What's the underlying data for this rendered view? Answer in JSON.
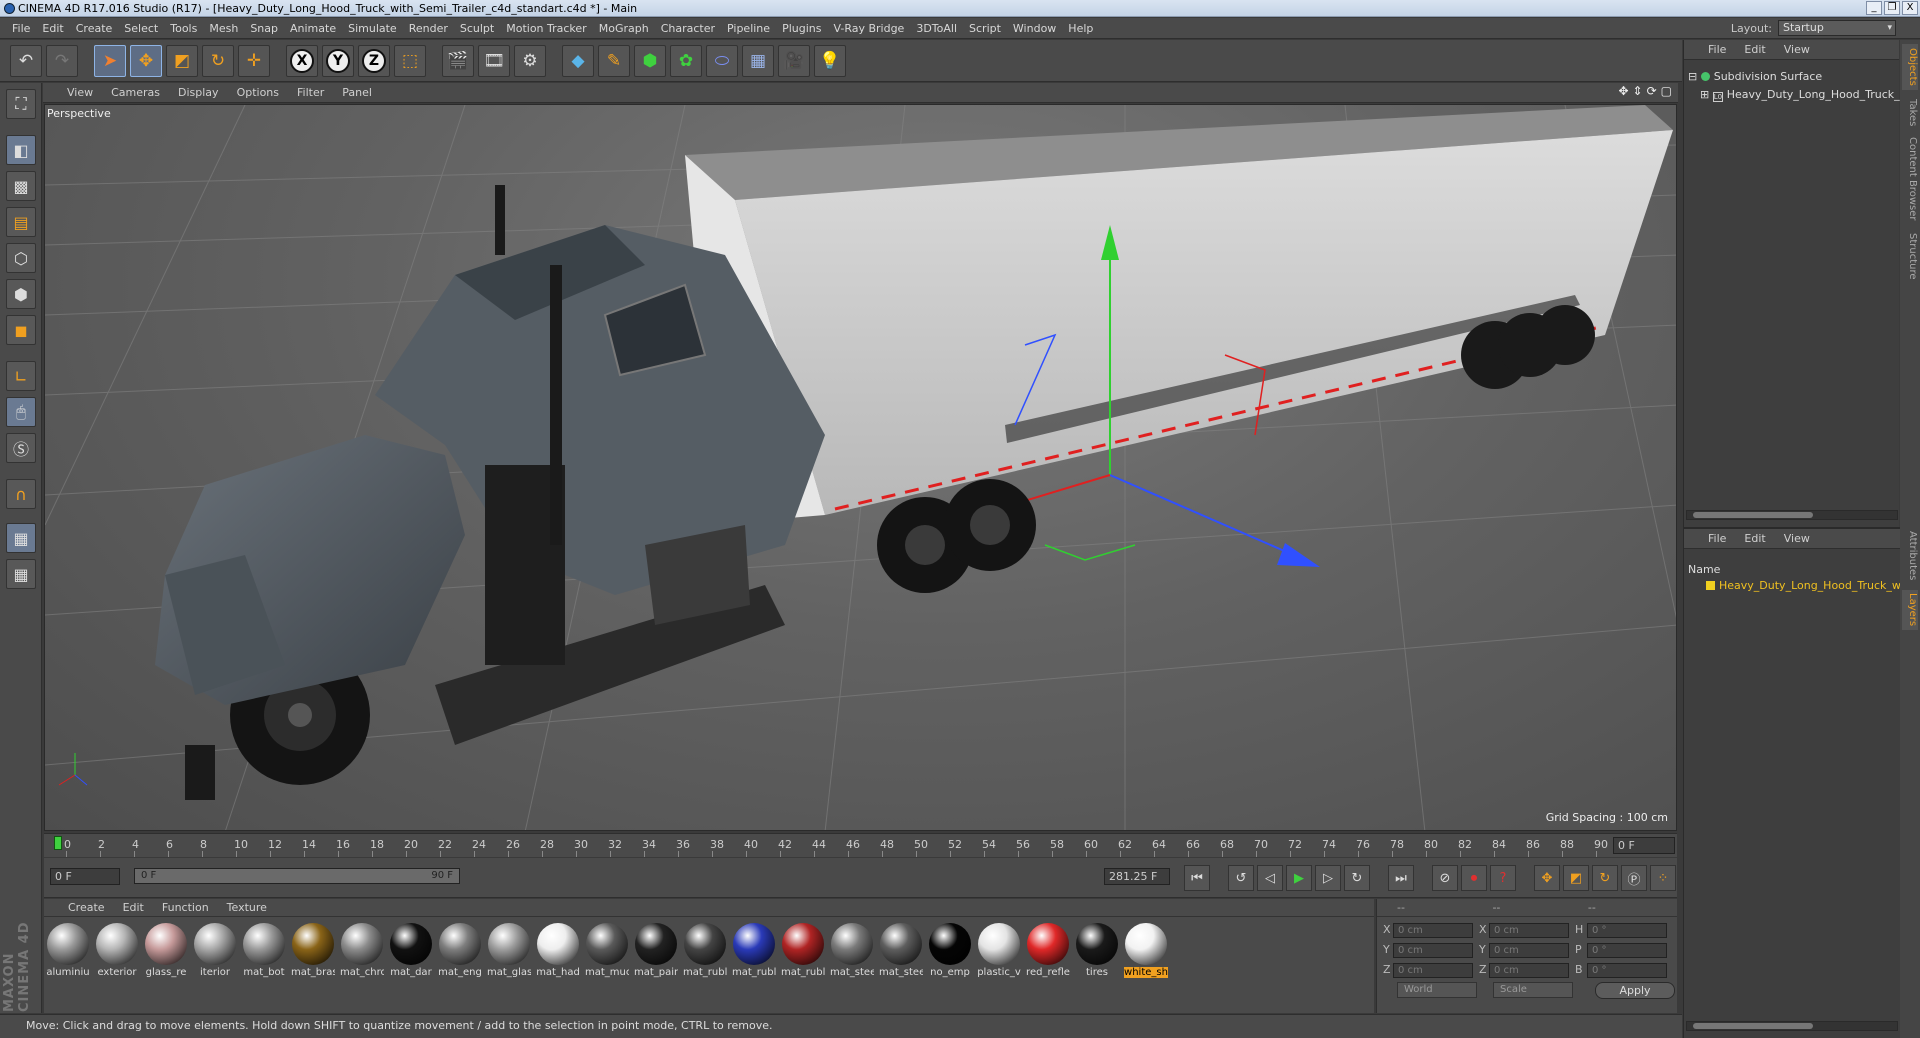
{
  "window": {
    "title": "CINEMA 4D R17.016 Studio (R17) - [Heavy_Duty_Long_Hood_Truck_with_Semi_Trailer_c4d_standart.c4d *] - Main",
    "controls": [
      "_",
      "❐",
      "X"
    ]
  },
  "menu": [
    "File",
    "Edit",
    "Create",
    "Select",
    "Tools",
    "Mesh",
    "Snap",
    "Animate",
    "Simulate",
    "Render",
    "Sculpt",
    "Motion Tracker",
    "MoGraph",
    "Character",
    "Pipeline",
    "Plugins",
    "V-Ray Bridge",
    "3DToAll",
    "Script",
    "Window",
    "Help"
  ],
  "layout": {
    "label": "Layout:",
    "value": "Startup"
  },
  "viewport": {
    "menu": [
      "View",
      "Cameras",
      "Display",
      "Options",
      "Filter",
      "Panel"
    ],
    "label": "Perspective",
    "grid_spacing": "Grid Spacing : 100 cm",
    "axis": {
      "x": "X",
      "y": "Y",
      "z": "Z"
    }
  },
  "timeline": {
    "ticks": [
      "0",
      "2",
      "4",
      "6",
      "8",
      "10",
      "12",
      "14",
      "16",
      "18",
      "20",
      "22",
      "24",
      "26",
      "28",
      "30",
      "32",
      "34",
      "36",
      "38",
      "40",
      "42",
      "44",
      "46",
      "48",
      "50",
      "52",
      "54",
      "56",
      "58",
      "60",
      "62",
      "64",
      "66",
      "68",
      "70",
      "72",
      "74",
      "76",
      "78",
      "80",
      "82",
      "84",
      "86",
      "88",
      "90"
    ],
    "current_frame": "0 F"
  },
  "transport": {
    "start_field": "0 F",
    "range_start": "0 F",
    "range_end": "90 F",
    "fps_field": "281.25 F"
  },
  "materials": {
    "menu": [
      "Create",
      "Edit",
      "Function",
      "Texture"
    ],
    "items": [
      {
        "label": "aluminiu",
        "color": "#9a9a9a"
      },
      {
        "label": "exterior",
        "color": "#b5b5b5"
      },
      {
        "label": "glass_re",
        "color": "#c69a9a"
      },
      {
        "label": "iterior",
        "color": "#a8a8a8"
      },
      {
        "label": "mat_bot",
        "color": "#9a9a9a"
      },
      {
        "label": "mat_bras",
        "color": "#8a6418"
      },
      {
        "label": "mat_chro",
        "color": "#8c8c8c"
      },
      {
        "label": "mat_dar",
        "color": "#111111"
      },
      {
        "label": "mat_eng",
        "color": "#7e7e7e"
      },
      {
        "label": "mat_glas",
        "color": "#9e9e9e"
      },
      {
        "label": "mat_had",
        "color": "#eeeeee"
      },
      {
        "label": "mat_muc",
        "color": "#5a5a5a"
      },
      {
        "label": "mat_pain",
        "color": "#222222"
      },
      {
        "label": "mat_rubl",
        "color": "#444444"
      },
      {
        "label": "mat_rubl",
        "color": "#2a3ab8"
      },
      {
        "label": "mat_rubl",
        "color": "#b02424"
      },
      {
        "label": "mat_stee",
        "color": "#7a7a7a"
      },
      {
        "label": "mat_stee",
        "color": "#5e5e5e"
      },
      {
        "label": "no_emp",
        "color": "#050505"
      },
      {
        "label": "plastic_v",
        "color": "#e4e4e4"
      },
      {
        "label": "red_refle",
        "color": "#e02828"
      },
      {
        "label": "tires",
        "color": "#1a1a1a"
      },
      {
        "label": "white_sh",
        "color": "#f2f2f2"
      }
    ]
  },
  "coordinates": {
    "headers": [
      "--",
      "--",
      "--"
    ],
    "rows": [
      {
        "a": "X",
        "av": "0 cm",
        "b": "X",
        "bv": "0 cm",
        "c": "H",
        "cv": "0 °"
      },
      {
        "a": "Y",
        "av": "0 cm",
        "b": "Y",
        "bv": "0 cm",
        "c": "P",
        "cv": "0 °"
      },
      {
        "a": "Z",
        "av": "0 cm",
        "b": "Z",
        "bv": "0 cm",
        "c": "B",
        "cv": "0 °"
      }
    ],
    "mode": "World",
    "scale": "Scale",
    "apply": "Apply"
  },
  "status": "Move: Click and drag to move elements. Hold down SHIFT to quantize movement / add to the selection in point mode, CTRL to remove.",
  "objects_panel": {
    "menu": [
      "File",
      "Edit",
      "View"
    ],
    "items": [
      "Subdivision Surface",
      "Heavy_Duty_Long_Hood_Truck_wi"
    ]
  },
  "layers_panel": {
    "menu": [
      "File",
      "Edit",
      "View"
    ],
    "name_header": "Name",
    "item": "Heavy_Duty_Long_Hood_Truck_wit"
  },
  "side_tabs": [
    "Objects",
    "Takes",
    "Content Browser",
    "Structure",
    "Attributes",
    "Layers"
  ],
  "maxon": "MAXON CINEMA 4D"
}
